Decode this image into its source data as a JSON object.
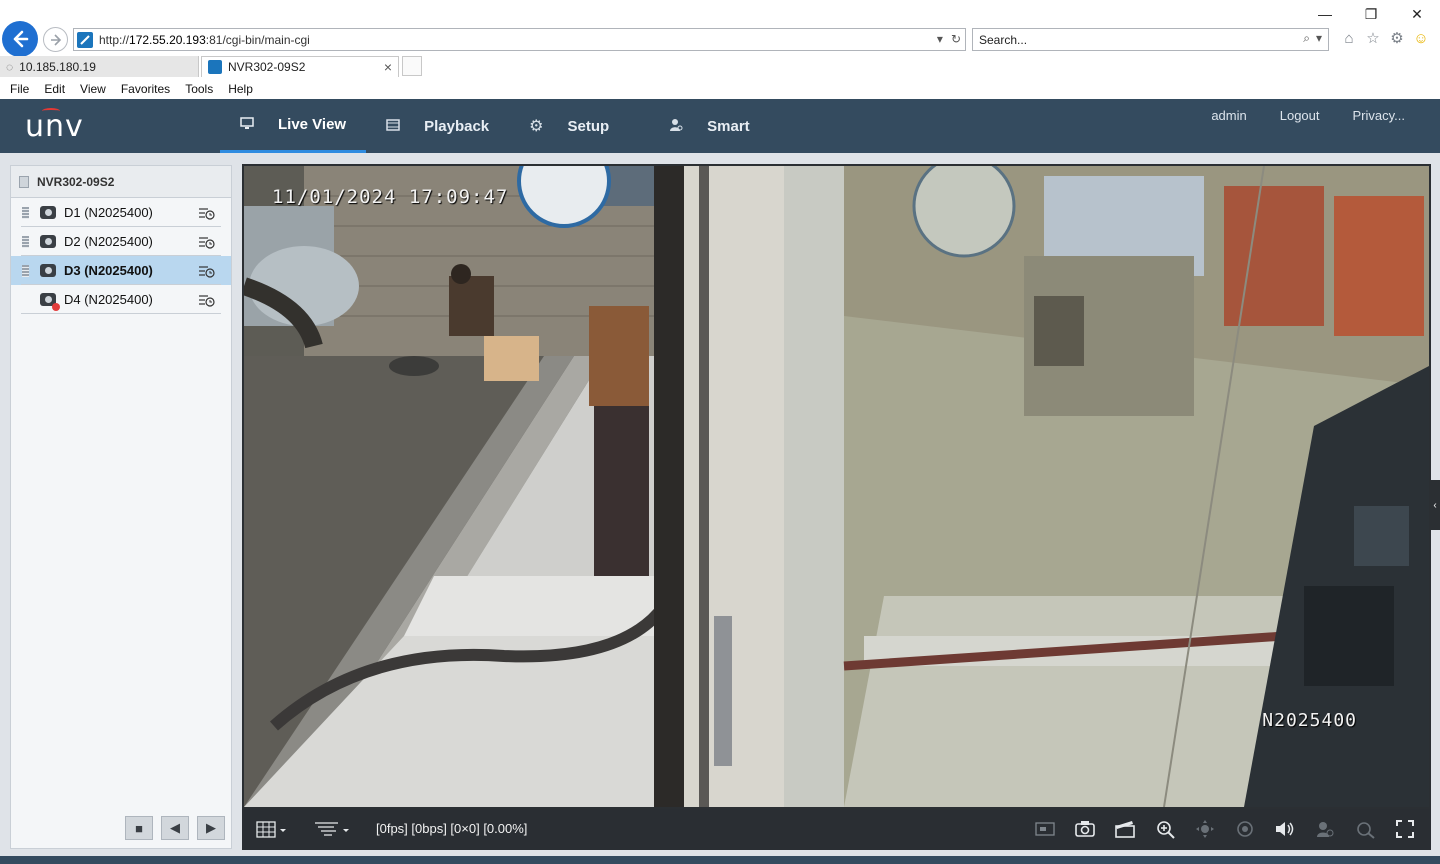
{
  "browser": {
    "url_prefix": "http://",
    "url_host": "172.55.20.193",
    "url_rest": ":81/cgi-bin/main-cgi",
    "search_placeholder": "Search...",
    "tabs": [
      {
        "label": "10.185.180.19",
        "active": false
      },
      {
        "label": "NVR302-09S2",
        "active": true
      }
    ],
    "menu": [
      "File",
      "Edit",
      "View",
      "Favorites",
      "Tools",
      "Help"
    ],
    "window_controls": {
      "minimize": "—",
      "restore": "❐",
      "close": "✕"
    }
  },
  "app": {
    "logo": "unv",
    "nav": [
      {
        "label": "Live View",
        "icon": "monitor-icon",
        "active": true
      },
      {
        "label": "Playback",
        "icon": "film-icon",
        "active": false
      },
      {
        "label": "Setup",
        "icon": "gear-icon",
        "active": false
      },
      {
        "label": "Smart",
        "icon": "person-search-icon",
        "active": false
      }
    ],
    "user": {
      "name": "admin",
      "logout": "Logout",
      "privacy": "Privacy..."
    }
  },
  "device_panel": {
    "device_name": "NVR302-09S2",
    "channels": [
      {
        "label": "D1 (N2025400)",
        "status": "online",
        "selected": false
      },
      {
        "label": "D2 (N2025400)",
        "status": "online",
        "selected": false
      },
      {
        "label": "D3 (N2025400)",
        "status": "online",
        "selected": true
      },
      {
        "label": "D4 (N2025400)",
        "status": "offline",
        "selected": false
      }
    ]
  },
  "video": {
    "osd_timestamp": "11/01/2024 17:09:47",
    "osd_channel_name": "N2025400",
    "status_text": "[0fps] [0bps] [0×0] [0.00%]"
  },
  "colors": {
    "header_bg": "#344b5f",
    "nav_active_underline": "#2f8ce0",
    "selected_row": "#b9d7ef",
    "toolbar_bg": "#2a2e33",
    "back_button": "#1f6fd1"
  }
}
